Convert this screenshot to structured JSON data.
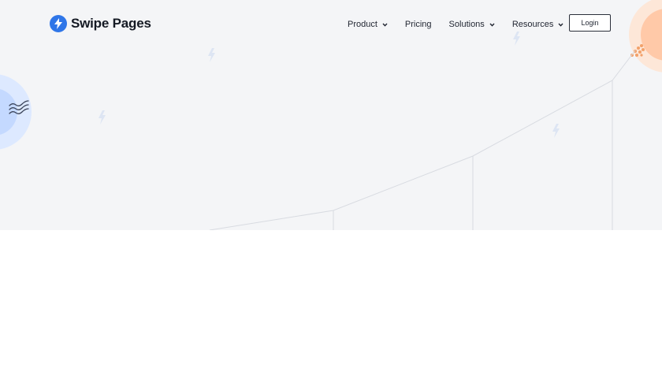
{
  "brand": {
    "name": "Swipe Pages",
    "primary_color": "#2f76e8"
  },
  "nav": {
    "items": [
      {
        "label": "Product",
        "has_dropdown": true
      },
      {
        "label": "Pricing",
        "has_dropdown": false
      },
      {
        "label": "Solutions",
        "has_dropdown": true
      },
      {
        "label": "Resources",
        "has_dropdown": true
      }
    ]
  },
  "actions": {
    "login_label": "Login"
  },
  "colors": {
    "hero_background": "#f4f5f7",
    "page_background": "#ffffff",
    "accent_blue": "#cfe0ff",
    "accent_orange": "#ffc9a8"
  },
  "icons": {
    "logo": "lightning-bolt-icon",
    "dropdown": "chevron-down-icon",
    "decorative": [
      "lightning-bolt-icon",
      "wave-lines-icon",
      "dots-cluster-icon"
    ]
  }
}
